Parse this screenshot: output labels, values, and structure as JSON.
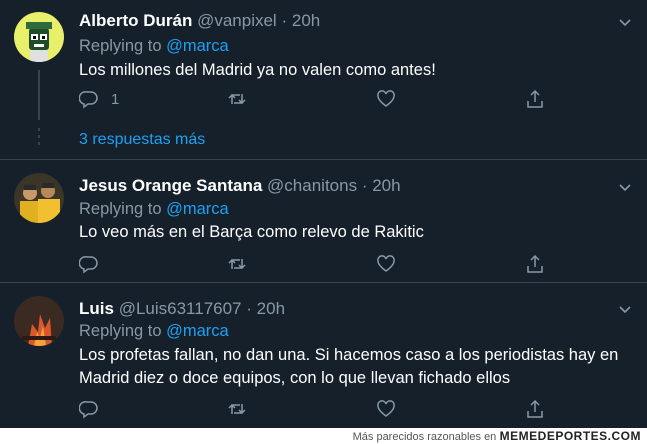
{
  "tweets": [
    {
      "name": "Alberto Durán",
      "handle": "@vanpixel",
      "dot": "·",
      "time": "20h",
      "replying_prefix": "Replying to ",
      "replying_to": "@marca",
      "text": "Los millones del Madrid ya no valen como antes!",
      "reply_count": "1",
      "more_replies": "3 respuestas más"
    },
    {
      "name": "Jesus Orange Santana",
      "handle": "@chanitons",
      "dot": "·",
      "time": "20h",
      "replying_prefix": "Replying to ",
      "replying_to": "@marca",
      "text": "Lo veo más en el Barça como relevo de Rakitic"
    },
    {
      "name": "Luis",
      "handle": "@Luis63117607",
      "dot": "·",
      "time": "20h",
      "replying_prefix": "Replying to ",
      "replying_to": "@marca",
      "text": "Los profetas fallan, no dan una. Si hacemos caso a los periodistas hay en Madrid diez o doce equipos, con lo que llevan fichado ellos"
    }
  ],
  "footer": {
    "prefix": "Más parecidos razonables en",
    "brand": "MEMEDEPORTES.COM"
  },
  "colors": {
    "background": "#15202b",
    "divider": "#38444d",
    "secondary_text": "#8899a6",
    "accent": "#1da1f2"
  },
  "icons": [
    "reply-icon",
    "retweet-icon",
    "like-icon",
    "share-icon",
    "chevron-down-icon"
  ]
}
